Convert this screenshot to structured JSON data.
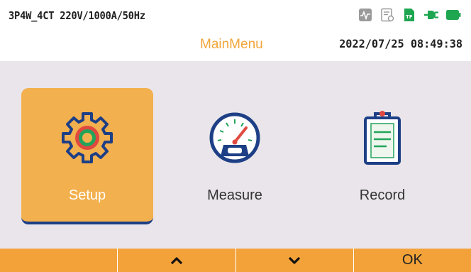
{
  "header": {
    "config": "3P4W_4CT 220V/1000A/50Hz",
    "title": "MainMenu",
    "datetime": "2022/07/25 08:49:38",
    "status_icons": [
      "waveform-icon",
      "report-icon",
      "tf-card-icon",
      "power-plug-icon",
      "battery-icon"
    ]
  },
  "menu": {
    "items": [
      {
        "label": "Setup",
        "icon": "gear-icon",
        "selected": true
      },
      {
        "label": "Measure",
        "icon": "gauge-icon",
        "selected": false
      },
      {
        "label": "Record",
        "icon": "clipboard-icon",
        "selected": false
      }
    ]
  },
  "softkeys": [
    {
      "label": "",
      "name": "softkey-1"
    },
    {
      "label": "⌃",
      "name": "up-button"
    },
    {
      "label": "⌄",
      "name": "down-button"
    },
    {
      "label": "OK",
      "name": "ok-button"
    }
  ],
  "colors": {
    "accent": "#f3b04e",
    "bar": "#f3a23a",
    "title": "#f2a53a",
    "icon_blue": "#1d3f86",
    "status_green": "#1fa650",
    "background": "#e9e5ea"
  }
}
